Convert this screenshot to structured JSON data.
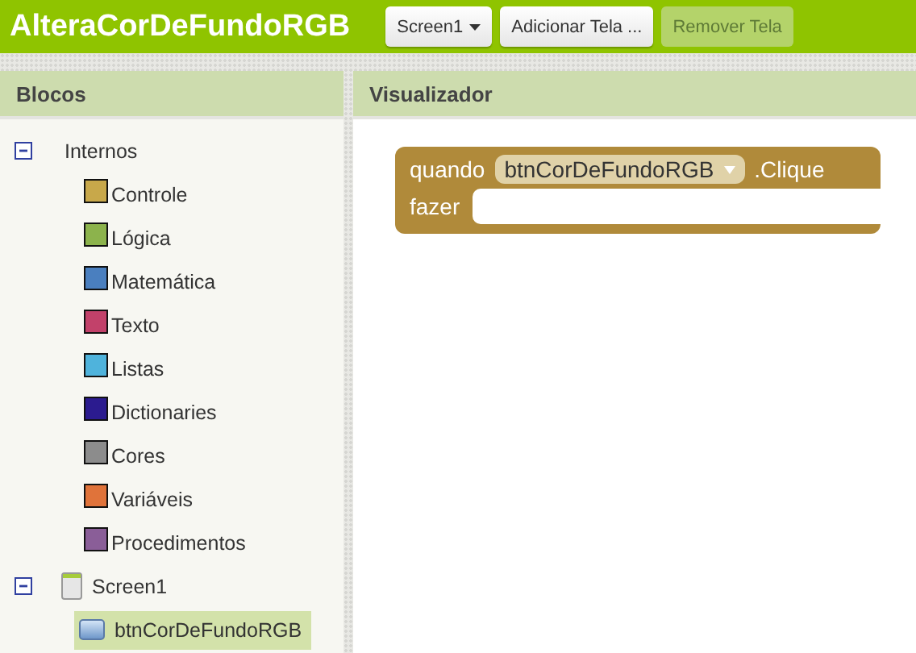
{
  "app_title": "AlteraCorDeFundoRGB",
  "toolbar": [
    {
      "label": "Screen1",
      "kind": "dropdown",
      "disabled": false
    },
    {
      "label": "Adicionar Tela ...",
      "kind": "button",
      "disabled": false
    },
    {
      "label": "Remover Tela",
      "kind": "button",
      "disabled": true
    }
  ],
  "blocks_panel": {
    "title": "Blocos",
    "tree": [
      {
        "label": "Internos",
        "kind": "folder",
        "expanded": true,
        "selected": false,
        "children": [
          {
            "label": "Controle",
            "kind": "category",
            "color": "#c8a84a",
            "selected": false
          },
          {
            "label": "Lógica",
            "kind": "category",
            "color": "#8cb34c",
            "selected": false
          },
          {
            "label": "Matemática",
            "kind": "category",
            "color": "#4a7fbf",
            "selected": false
          },
          {
            "label": "Texto",
            "kind": "category",
            "color": "#c2416a",
            "selected": false
          },
          {
            "label": "Listas",
            "kind": "category",
            "color": "#4fb3dc",
            "selected": false
          },
          {
            "label": "Dictionaries",
            "kind": "category",
            "color": "#2b1b8f",
            "selected": false
          },
          {
            "label": "Cores",
            "kind": "category",
            "color": "#8c8c8c",
            "selected": false
          },
          {
            "label": "Variáveis",
            "kind": "category",
            "color": "#e0733a",
            "selected": false
          },
          {
            "label": "Procedimentos",
            "kind": "category",
            "color": "#8a5e98",
            "selected": false
          }
        ]
      },
      {
        "label": "Screen1",
        "kind": "screen",
        "expanded": true,
        "selected": false,
        "children": [
          {
            "label": "btnCorDeFundoRGB",
            "kind": "button",
            "selected": true
          }
        ]
      }
    ]
  },
  "viewer_panel": {
    "title": "Visualizador",
    "event_block": {
      "when": "quando",
      "component": "btnCorDeFundoRGB",
      "event": ".Clique",
      "do": "fazer"
    }
  }
}
